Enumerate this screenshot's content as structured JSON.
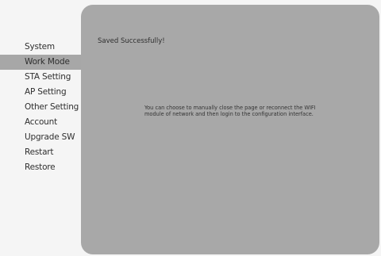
{
  "sidebar": {
    "items": [
      {
        "label": "System",
        "active": false
      },
      {
        "label": "Work Mode",
        "active": true
      },
      {
        "label": "STA Setting",
        "active": false
      },
      {
        "label": "AP Setting",
        "active": false
      },
      {
        "label": "Other Setting",
        "active": false
      },
      {
        "label": "Account",
        "active": false
      },
      {
        "label": "Upgrade SW",
        "active": false
      },
      {
        "label": "Restart",
        "active": false
      },
      {
        "label": "Restore",
        "active": false
      }
    ]
  },
  "main": {
    "status_message": "Saved Successfully!",
    "info_text": "You can choose to manually close the page or reconnect the WIFI module of network and then login to the configuration interface."
  },
  "colors": {
    "page_background": "#f5f5f5",
    "panel_background": "#a8a8a8",
    "active_item_background": "#a7a7a7",
    "text": "#2f2f2f"
  }
}
